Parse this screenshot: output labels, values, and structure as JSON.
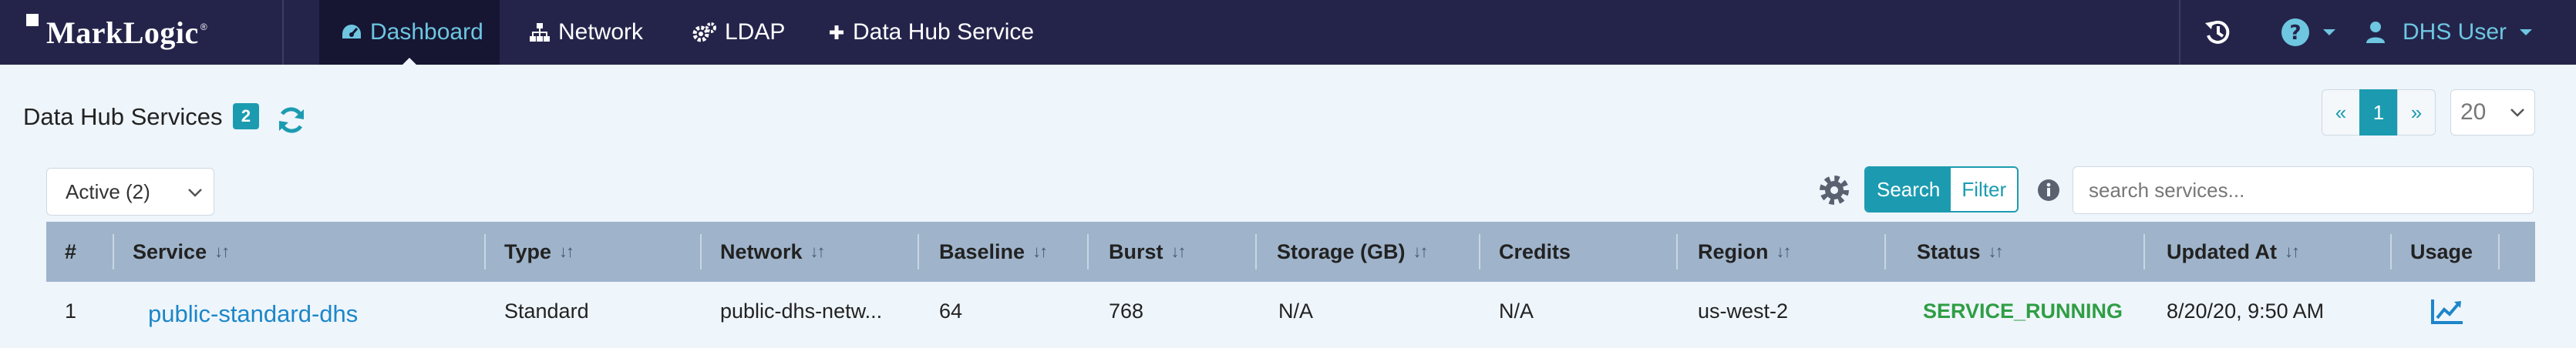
{
  "brand": {
    "name": "MarkLogic",
    "reg": "®"
  },
  "nav": {
    "items": [
      {
        "label": "Dashboard",
        "icon": "tachometer-icon",
        "active": true
      },
      {
        "label": "Network",
        "icon": "sitemap-icon",
        "active": false
      },
      {
        "label": "LDAP",
        "icon": "cogs-icon",
        "active": false
      },
      {
        "label": "Data Hub Service",
        "icon": "plus-icon",
        "active": false
      }
    ],
    "user_label": "DHS User"
  },
  "header": {
    "title": "Data Hub Services",
    "count": "2"
  },
  "pagination": {
    "prev": "«",
    "current": "1",
    "next": "»",
    "page_size": "20"
  },
  "toolbar": {
    "status_filter": "Active (2)",
    "search_label": "Search",
    "filter_label": "Filter",
    "search_placeholder": "search services..."
  },
  "table": {
    "columns": [
      "#",
      "Service",
      "Type",
      "Network",
      "Baseline",
      "Burst",
      "Storage (GB)",
      "Credits",
      "Region",
      "Status",
      "Updated At",
      "Usage"
    ],
    "sortable": [
      false,
      true,
      true,
      true,
      true,
      true,
      true,
      false,
      true,
      true,
      true,
      false
    ],
    "sort_glyph": "↓↑",
    "rows": [
      {
        "index": "1",
        "service": "public-standard-dhs",
        "type": "Standard",
        "network": "public-dhs-netw...",
        "baseline": "64",
        "burst": "768",
        "storage": "N/A",
        "credits": "N/A",
        "region": "us-west-2",
        "status": "SERVICE_RUNNING",
        "updated": "8/20/20, 9:50 AM"
      }
    ]
  },
  "colors": {
    "nav_bg": "#24244b",
    "accent": "#1c9bb0",
    "link": "#1c86c8",
    "status_running": "#2f9e44",
    "table_header": "#9fb4cb",
    "page_bg": "#eef5fb"
  }
}
